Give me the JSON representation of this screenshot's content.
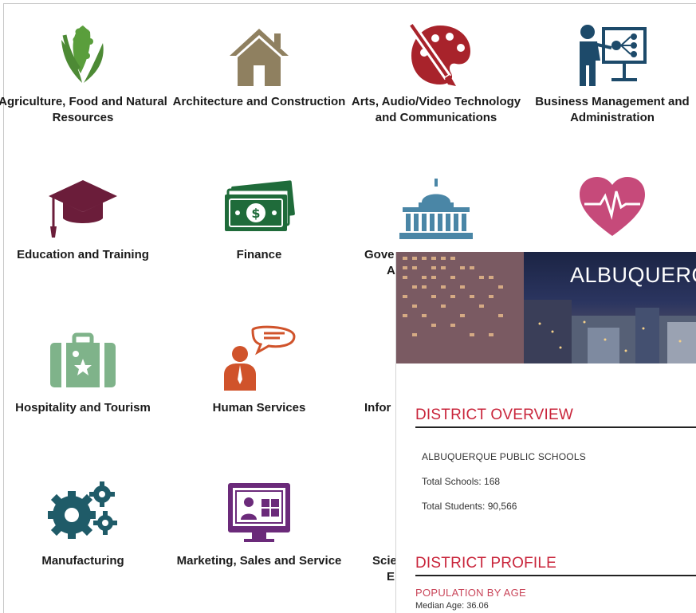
{
  "clusters": [
    {
      "label": "Agriculture, Food and Natural Resources",
      "icon": "corn-icon",
      "color": "#5a9e3c"
    },
    {
      "label": "Architecture and Construction",
      "icon": "house-icon",
      "color": "#8f8060"
    },
    {
      "label": "Arts, Audio/Video Technology and Communications",
      "icon": "palette-icon",
      "color": "#a8232b"
    },
    {
      "label": "Business Management and Administration",
      "icon": "presenter-icon",
      "color": "#1d4a6a"
    },
    {
      "label": "Education and Training",
      "icon": "graduation-cap-icon",
      "color": "#6b1d3a"
    },
    {
      "label": "Finance",
      "icon": "money-icon",
      "color": "#1f6b3a"
    },
    {
      "label": "Gove",
      "icon": "capitol-icon",
      "color": "#4a86a6"
    },
    {
      "label": "",
      "icon": "heart-pulse-icon",
      "color": "#c64a7a"
    },
    {
      "label": "Hospitality and Tourism",
      "icon": "suitcase-icon",
      "color": "#7fb38a"
    },
    {
      "label": "Human Services",
      "icon": "person-speech-icon",
      "color": "#d0532b"
    },
    {
      "label": "Infor",
      "icon": "",
      "color": ""
    },
    {
      "label": "Manufacturing",
      "icon": "gears-icon",
      "color": "#1f5b68"
    },
    {
      "label": "Marketing, Sales and Service",
      "icon": "monitor-icon",
      "color": "#6b2a7a"
    },
    {
      "label": "Scie",
      "icon": "",
      "color": ""
    }
  ],
  "clipped": {
    "gov_line2": "A",
    "sci_line2": "E"
  },
  "district": {
    "banner_title": "ALBUQUERQ",
    "overview_heading": "DISTRICT OVERVIEW",
    "name": "ALBUQUERQUE PUBLIC SCHOOLS",
    "schools": "Total Schools: 168",
    "students": "Total Students: 90,566",
    "profile_heading": "DISTRICT PROFILE",
    "population_heading": "POPULATION BY AGE",
    "median_age": "Median Age: 36.06"
  }
}
